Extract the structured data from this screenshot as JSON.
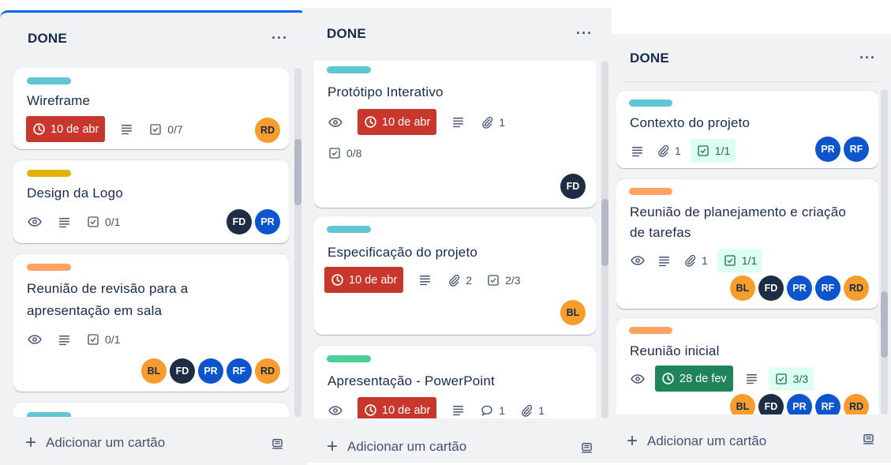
{
  "columns": [
    {
      "title": "DONE",
      "add_label": "Adicionar um cartão",
      "cards": [
        {
          "title": "Wireframe",
          "due": "10 de abr",
          "checklist": "0/7",
          "avatars": [
            "RD"
          ]
        },
        {
          "title": "Design da Logo",
          "checklist": "0/1",
          "avatars": [
            "FD",
            "PR"
          ]
        },
        {
          "title_line1": "Reunião de revisão para a",
          "title_line2": "apresentação em sala",
          "checklist": "0/1",
          "avatars": [
            "BL",
            "FD",
            "PR",
            "RF",
            "RD"
          ]
        }
      ]
    },
    {
      "title": "DONE",
      "add_label": "Adicionar um cartão",
      "cards": [
        {
          "title": "Protótipo Interativo",
          "due": "10 de abr",
          "attachments": "1",
          "checklist": "0/8",
          "avatars": [
            "FD"
          ]
        },
        {
          "title": "Especificação do projeto",
          "due": "10 de abr",
          "attachments": "2",
          "checklist": "2/3",
          "avatars": [
            "BL"
          ]
        },
        {
          "title": "Apresentação - PowerPoint",
          "due": "10 de abr",
          "comments": "1",
          "attachments": "1"
        }
      ]
    },
    {
      "title": "DONE",
      "add_label": "Adicionar um cartão",
      "cards": [
        {
          "title": "Contexto do projeto",
          "attachments": "1",
          "checklist": "1/1",
          "avatars": [
            "PR",
            "RF"
          ]
        },
        {
          "title_line1": "Reunião de planejamento e criação",
          "title_line2": "de tarefas",
          "attachments": "1",
          "checklist": "1/1",
          "avatars": [
            "BL",
            "FD",
            "PR",
            "RF",
            "RD"
          ]
        },
        {
          "title": "Reunião inicial",
          "due": "28 de fev",
          "checklist": "3/3",
          "avatars": [
            "BL",
            "FD",
            "PR",
            "RF",
            "RD"
          ]
        }
      ]
    }
  ],
  "colors": {
    "label_teal": "#60c6d2",
    "label_yellow": "#e2b203",
    "label_orange": "#fea362",
    "label_green": "#4bce97",
    "due_red": "#c9372c",
    "due_green": "#1f845a"
  }
}
